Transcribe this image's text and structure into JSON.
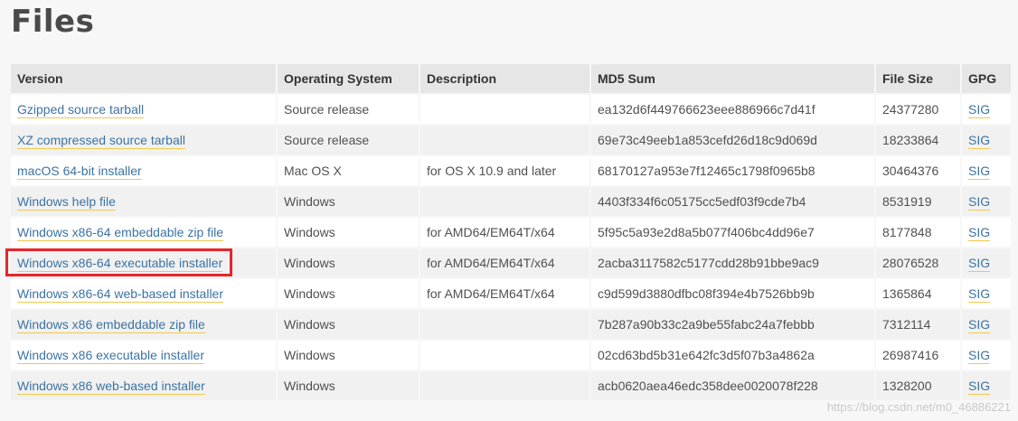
{
  "page": {
    "title": "Files"
  },
  "table": {
    "headers": [
      "Version",
      "Operating System",
      "Description",
      "MD5 Sum",
      "File Size",
      "GPG"
    ],
    "rows": [
      {
        "version": "Gzipped source tarball",
        "os": "Source release",
        "description": "",
        "md5": "ea132d6f449766623eee886966c7d41f",
        "size": "24377280",
        "gpg": "SIG"
      },
      {
        "version": "XZ compressed source tarball",
        "os": "Source release",
        "description": "",
        "md5": "69e73c49eeb1a853cefd26d18c9d069d",
        "size": "18233864",
        "gpg": "SIG"
      },
      {
        "version": "macOS 64-bit installer",
        "os": "Mac OS X",
        "description": "for OS X 10.9 and later",
        "md5": "68170127a953e7f12465c1798f0965b8",
        "size": "30464376",
        "gpg": "SIG"
      },
      {
        "version": "Windows help file",
        "os": "Windows",
        "description": "",
        "md5": "4403f334f6c05175cc5edf03f9cde7b4",
        "size": "8531919",
        "gpg": "SIG"
      },
      {
        "version": "Windows x86-64 embeddable zip file",
        "os": "Windows",
        "description": "for AMD64/EM64T/x64",
        "md5": "5f95c5a93e2d8a5b077f406bc4dd96e7",
        "size": "8177848",
        "gpg": "SIG"
      },
      {
        "version": "Windows x86-64 executable installer",
        "os": "Windows",
        "description": "for AMD64/EM64T/x64",
        "md5": "2acba3117582c5177cdd28b91bbe9ac9",
        "size": "28076528",
        "gpg": "SIG"
      },
      {
        "version": "Windows x86-64 web-based installer",
        "os": "Windows",
        "description": "for AMD64/EM64T/x64",
        "md5": "c9d599d3880dfbc08f394e4b7526bb9b",
        "size": "1365864",
        "gpg": "SIG"
      },
      {
        "version": "Windows x86 embeddable zip file",
        "os": "Windows",
        "description": "",
        "md5": "7b287a90b33c2a9be55fabc24a7febbb",
        "size": "7312114",
        "gpg": "SIG"
      },
      {
        "version": "Windows x86 executable installer",
        "os": "Windows",
        "description": "",
        "md5": "02cd63bd5b31e642fc3d5f07b3a4862a",
        "size": "26987416",
        "gpg": "SIG"
      },
      {
        "version": "Windows x86 web-based installer",
        "os": "Windows",
        "description": "",
        "md5": "acb0620aea46edc358dee0020078f228",
        "size": "1328200",
        "gpg": "SIG"
      }
    ]
  },
  "highlight": {
    "color": "#e6262b"
  },
  "watermark": {
    "text": "https://blog.csdn.net/m0_46886221"
  },
  "colors": {
    "link": "#3b73a3",
    "link_underline": "#f0c94c",
    "header_bg": "#e6e6e6"
  }
}
